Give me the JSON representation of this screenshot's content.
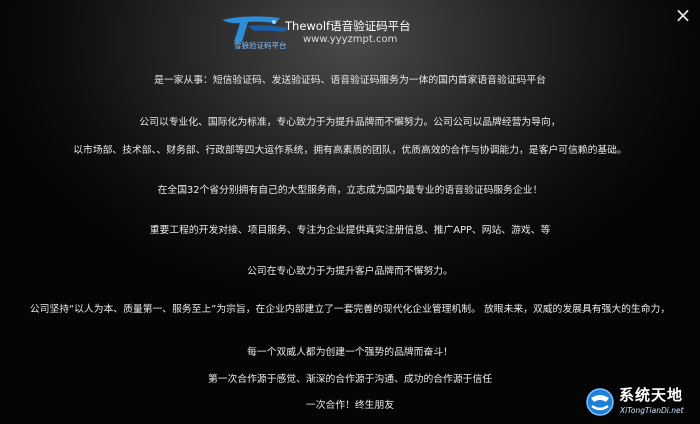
{
  "window": {
    "close_glyph": "×"
  },
  "header": {
    "logo_text": "雪狼验证码平台",
    "brand_name": "Thewolf语音验证码平台",
    "brand_url": "www.yyyzmpt.com"
  },
  "paragraphs": [
    "是一家从事：短信验证码、发送验证码、语音验证码服务为一体的国内首家语音验证码平台",
    "公司以专业化、国际化为标准，专心致力于为提升品牌而不懈努力。公司公司以品牌经营为导向，",
    "以市场部、技术部、、财务部、行政部等四大运作系统，拥有高素质的团队，优质高效的合作与协调能力，是客户可信赖的基础。",
    "在全国32个省分别拥有自己的大型服务商，立志成为国内最专业的语音验证码服务企业！",
    "重要工程的开发对接、项目服务、专注为企业提供真实注册信息、推广APP、网站、游戏、等",
    "公司在专心致力于为提升客户品牌而不懈努力。",
    "公司坚持“以人为本、质量第一、服务至上”为宗旨，在企业内部建立了一套完善的现代化企业管理机制。 放眼未来，双威的发展具有强大的生命力，",
    "每一个双威人都为创建一个强势的品牌而奋斗！",
    "第一次合作源于感觉、渐深的合作源于沟通、成功的合作源于信任",
    "一次合作！终生朋友"
  ],
  "watermark": {
    "title": "系统天地",
    "subtitle": "XiTongTianDi.net"
  },
  "colors": {
    "accent_blue": "#1e7fd6",
    "logo_blue": "#2a8fd8"
  }
}
